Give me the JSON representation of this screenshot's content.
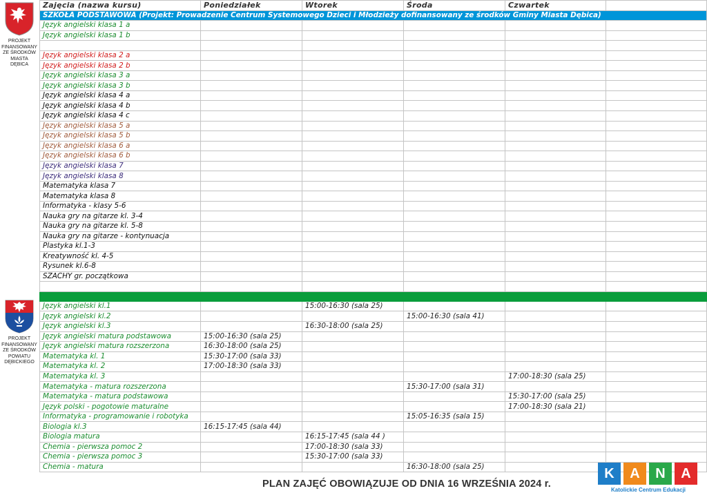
{
  "side_top": {
    "lines": [
      "PROJEKT",
      "FINANSOWANY",
      "ZE ŚRODKÓW",
      "MIASTA",
      "DĘBICA"
    ]
  },
  "side_bottom": {
    "lines": [
      "PROJEKT",
      "FINANSOWANY",
      "ZE ŚRODKÓW",
      "POWIATU",
      "DĘBICKIEGO"
    ]
  },
  "header": [
    "Zajęcia (nazwa kursu)",
    "Poniedziałek",
    "Wtorek",
    "Środa",
    "Czwartek",
    ""
  ],
  "banner": "SZKOŁA PODSTAWOWA  (Projekt: Prowadzenie Centrum Systemowego Dzieci i Młodzieży dofinansowany ze środków Gminy Miasta Dębica)",
  "rows_a": [
    {
      "name": "Język angielski klasa 1 a",
      "color": "g"
    },
    {
      "name": "Język angielski klasa 1 b",
      "color": "g"
    },
    {
      "name": "",
      "color": "k"
    },
    {
      "name": "Język angielski klasa 2 a",
      "color": "r"
    },
    {
      "name": "Język angielski klasa 2 b",
      "color": "r"
    },
    {
      "name": "Język angielski klasa 3 a",
      "color": "g"
    },
    {
      "name": "Język angielski klasa 3 b",
      "color": "g"
    },
    {
      "name": "Język angielski klasa 4 a",
      "color": "k"
    },
    {
      "name": "Język angielski klasa 4 b",
      "color": "k"
    },
    {
      "name": "Język angielski klasa 4 c",
      "color": "k"
    },
    {
      "name": "Język angielski klasa 5 a",
      "color": "b"
    },
    {
      "name": "Język angielski klasa 5 b",
      "color": "b"
    },
    {
      "name": "Język angielski klasa 6 a",
      "color": "b"
    },
    {
      "name": "Język angielski klasa 6 b",
      "color": "b"
    },
    {
      "name": "Język angielski klasa 7",
      "color": "p"
    },
    {
      "name": "Język angielski klasa 8",
      "color": "p"
    },
    {
      "name": "Matematyka klasa 7",
      "color": "k"
    },
    {
      "name": "Matematyka klasa 8",
      "color": "k"
    },
    {
      "name": "Informatyka - klasy 5-6",
      "color": "k"
    },
    {
      "name": "Nauka gry na gitarze kl. 3-4",
      "color": "k"
    },
    {
      "name": "Nauka gry na gitarze kl. 5-8",
      "color": "k"
    },
    {
      "name": "Nauka gry na gitarze - kontynuacja",
      "color": "k"
    },
    {
      "name": "Plastyka kl.1-3",
      "color": "k"
    },
    {
      "name": "Kreatywność kl. 4-5",
      "color": "k"
    },
    {
      "name": "Rysunek kl.6-8",
      "color": "k"
    },
    {
      "name": "SZACHY gr. początkowa",
      "color": "k"
    },
    {
      "name": "",
      "color": "k"
    }
  ],
  "rows_b": [
    {
      "name": "Język angielski kl.1",
      "mon": "",
      "tue": "15:00-16:30 (sala 25)",
      "wed": "",
      "thu": ""
    },
    {
      "name": "Język angielski kl.2",
      "mon": "",
      "tue": "",
      "wed": "15:00-16:30 (sala 41)",
      "thu": ""
    },
    {
      "name": "Język angielski kl.3",
      "mon": "",
      "tue": "16:30-18:00 (sala 25)",
      "wed": "",
      "thu": ""
    },
    {
      "name": "Język angielski matura podstawowa",
      "mon": "15:00-16:30 (sala 25)",
      "tue": "",
      "wed": "",
      "thu": ""
    },
    {
      "name": "Język angielski matura rozszerzona",
      "mon": "16:30-18:00 (sala 25)",
      "tue": "",
      "wed": "",
      "thu": ""
    },
    {
      "name": "Matematyka kl. 1",
      "mon": "15:30-17:00 (sala 33)",
      "tue": "",
      "wed": "",
      "thu": ""
    },
    {
      "name": "Matematyka kl. 2",
      "mon": "17:00-18:30 (sala 33)",
      "tue": "",
      "wed": "",
      "thu": ""
    },
    {
      "name": "Matematyka kl. 3",
      "mon": "",
      "tue": "",
      "wed": "",
      "thu": "17:00-18:30 (sala 25)"
    },
    {
      "name": "Matematyka - matura rozszerzona",
      "mon": "",
      "tue": "",
      "wed": "15:30-17:00 (sala 31)",
      "thu": ""
    },
    {
      "name": "Matematyka - matura podstawowa",
      "mon": "",
      "tue": "",
      "wed": "",
      "thu": "15:30-17:00 (sala 25)"
    },
    {
      "name": "Język polski - pogotowie maturalne",
      "mon": "",
      "tue": "",
      "wed": "",
      "thu": "17:00-18:30 (sala 21)"
    },
    {
      "name": "Informatyka - programowanie i robotyka",
      "mon": "",
      "tue": "",
      "wed": "15:05-16:35 (sala 15)",
      "thu": ""
    },
    {
      "name": "Biologia kl.3",
      "mon": "16:15-17:45 (sala 44)",
      "tue": "",
      "wed": "",
      "thu": ""
    },
    {
      "name": "Biologia matura",
      "mon": "",
      "tue": "16:15-17:45 (sala 44 )",
      "wed": "",
      "thu": ""
    },
    {
      "name": "Chemia - pierwsza pomoc 2",
      "mon": "",
      "tue": "17:00-18:30 (sala 33)",
      "wed": "",
      "thu": ""
    },
    {
      "name": "Chemia - pierwsza pomoc 3",
      "mon": "",
      "tue": "15:30-17:00 (sala 33)",
      "wed": "",
      "thu": ""
    },
    {
      "name": "Chemia - matura",
      "mon": "",
      "tue": "",
      "wed": "16:30-18:00 (sala 25)",
      "thu": ""
    }
  ],
  "footer": "PLAN ZAJĘĆ OBOWIĄZUJE OD DNIA 16 WRZEŚNIA 2024 r.",
  "kana": {
    "letters": [
      {
        "ch": "K",
        "color": "#1e7ec8"
      },
      {
        "ch": "A",
        "color": "#f08a1c"
      },
      {
        "ch": "N",
        "color": "#2aa84a"
      },
      {
        "ch": "A",
        "color": "#e32b2b"
      }
    ],
    "subtitle": "Katolickie Centrum Edukacji"
  },
  "colors": {
    "banner": "#0095d9",
    "green_bar": "#0a9d3c"
  },
  "icons": [
    "debica-city-crest-icon",
    "debica-county-crest-icon"
  ]
}
